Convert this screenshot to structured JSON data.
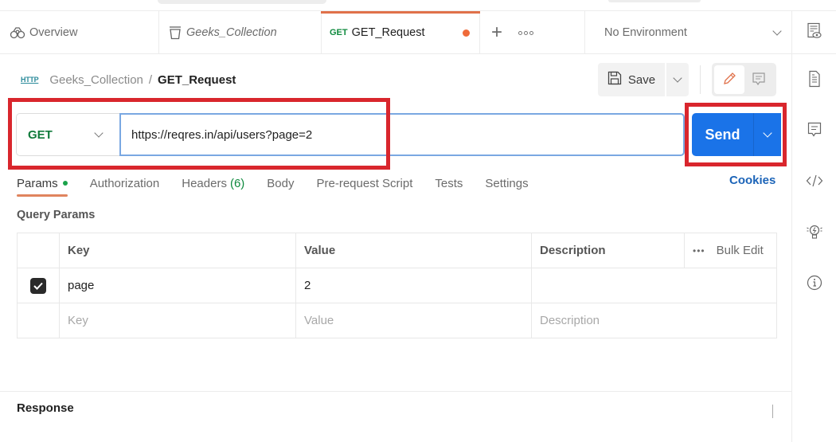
{
  "tabs": {
    "overview_label": "Overview",
    "collection_label": "Geeks_Collection",
    "request_method": "GET",
    "request_label": "GET_Request",
    "unsaved_indicator_color": "#ef6b3a"
  },
  "environment": {
    "selected": "No Environment"
  },
  "breadcrumb": {
    "protocol_icon": "HTTP",
    "collection": "Geeks_Collection",
    "separator": "/",
    "request": "GET_Request"
  },
  "toolbar": {
    "save_label": "Save"
  },
  "request": {
    "method": "GET",
    "url": "https://reqres.in/api/users?page=2",
    "send_label": "Send",
    "send_color": "#1a73e8"
  },
  "request_tabs": [
    {
      "label": "Params",
      "active": true,
      "indicator": "green-dot"
    },
    {
      "label": "Authorization"
    },
    {
      "label": "Headers",
      "count": "(6)"
    },
    {
      "label": "Body"
    },
    {
      "label": "Pre-request Script"
    },
    {
      "label": "Tests"
    },
    {
      "label": "Settings"
    }
  ],
  "cookies_label": "Cookies",
  "query_params": {
    "title": "Query Params",
    "headers": {
      "key": "Key",
      "value": "Value",
      "description": "Description",
      "bulk_edit": "Bulk Edit"
    },
    "rows": [
      {
        "checked": true,
        "key": "page",
        "value": "2",
        "description": ""
      }
    ],
    "placeholders": {
      "key": "Key",
      "value": "Value",
      "description": "Description"
    }
  },
  "response": {
    "title": "Response"
  },
  "highlight_color": "#d9262d"
}
